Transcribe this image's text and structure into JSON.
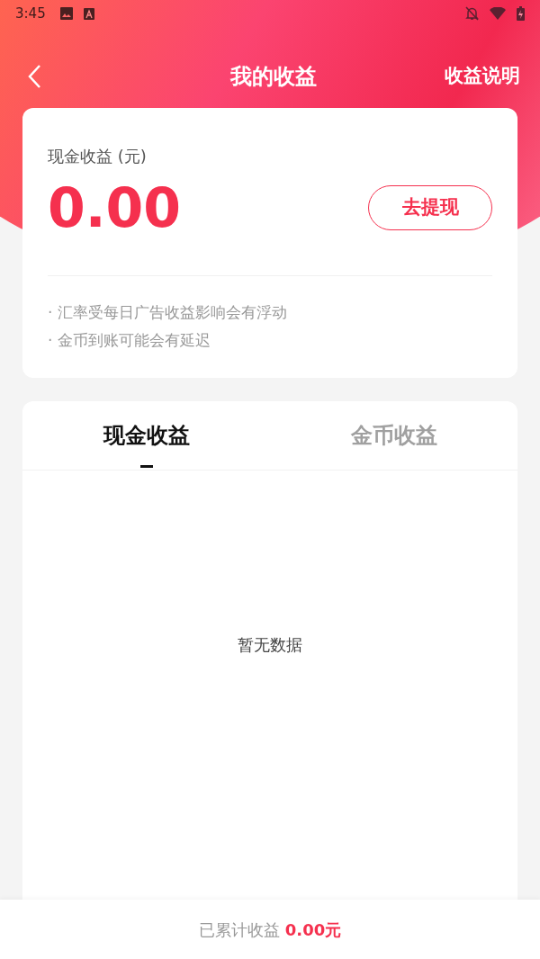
{
  "status_bar": {
    "time": "3:45"
  },
  "header": {
    "title": "我的收益",
    "action": "收益说明"
  },
  "balance_card": {
    "label": "现金收益 (元)",
    "amount": "0.00",
    "button": "去提现",
    "notes": [
      "· 汇率受每日广告收益影响会有浮动",
      "· 金币到账可能会有延迟"
    ]
  },
  "tabs": [
    {
      "label": "现金收益",
      "selected": true
    },
    {
      "label": "金币收益",
      "selected": false
    }
  ],
  "empty_state": "暂无数据",
  "footer": {
    "label": "已累计收益",
    "amount": "0.00元"
  }
}
